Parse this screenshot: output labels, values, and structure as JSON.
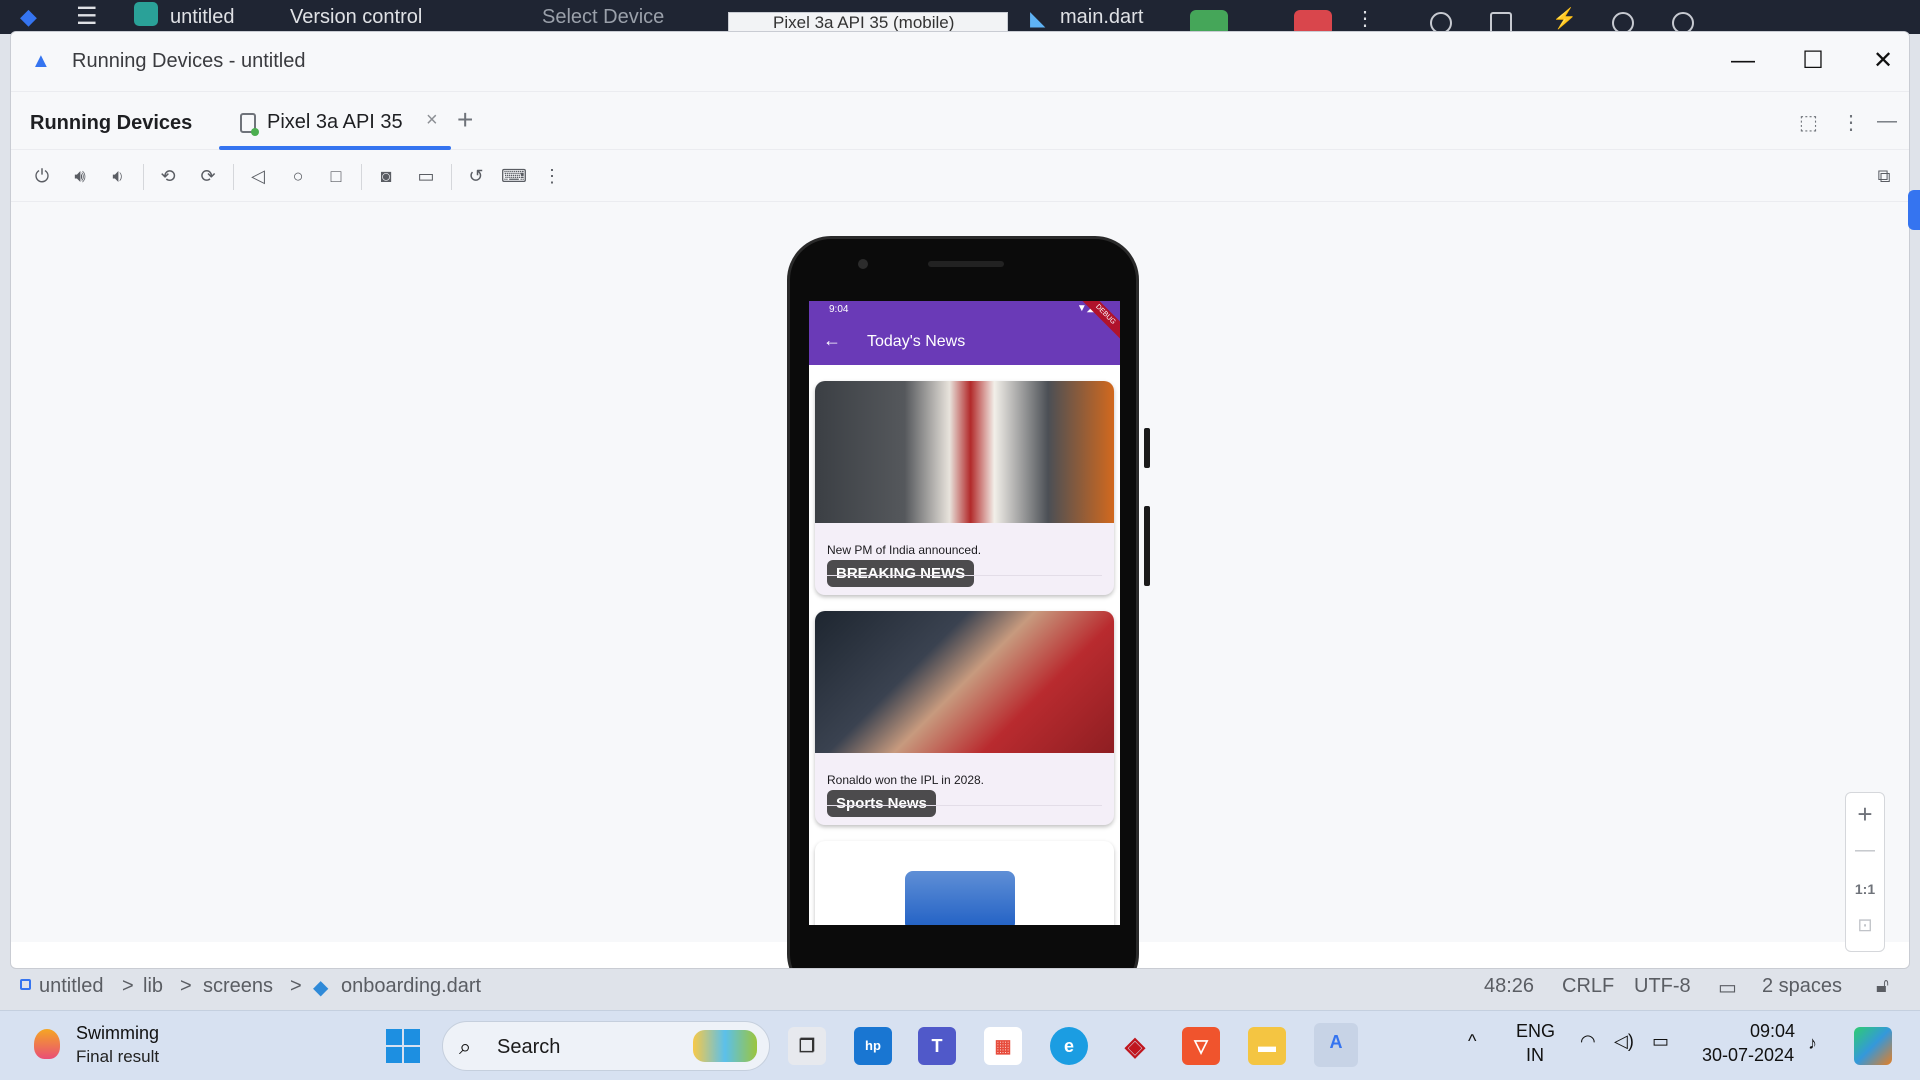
{
  "bg_ide": {
    "project": "untitled",
    "vcs": "Version control",
    "device_select": "Select Device",
    "device_combo": "Pixel 3a API 35 (mobile)",
    "run_config": "main.dart"
  },
  "window": {
    "title": "Running Devices - untitled",
    "minimize": "—",
    "maximize": "☐",
    "close": "✕"
  },
  "panel": {
    "title": "Running Devices",
    "tab_label": "Pixel 3a API 35",
    "tab_close": "×",
    "add_tab": "+"
  },
  "toolbar": {
    "icons": [
      "power-icon",
      "volume-up-icon",
      "volume-down-icon",
      "rotate-left-icon",
      "rotate-right-icon",
      "back-icon",
      "home-icon",
      "overview-icon",
      "screenshot-icon",
      "record-icon",
      "reset-icon",
      "keyboard-icon",
      "more-icon"
    ]
  },
  "emulator": {
    "status_time": "9:04",
    "app_title": "Today's News",
    "debug_banner": "DEBUG",
    "cards": [
      {
        "tag": "BREAKING NEWS",
        "desc": "New PM of India announced."
      },
      {
        "tag": "Sports News",
        "desc": "Ronaldo won the IPL in 2028."
      }
    ]
  },
  "zoom": {
    "plus": "+",
    "minus": "—",
    "actual": "1:1"
  },
  "breadcrumb": {
    "project": "untitled",
    "lib": "lib",
    "screens": "screens",
    "file": "onboarding.dart",
    "sep": ">"
  },
  "status": {
    "position": "48:26",
    "line_sep": "CRLF",
    "encoding": "UTF-8",
    "indent": "2 spaces"
  },
  "taskbar": {
    "widget_title": "Swimming",
    "widget_sub": "Final result",
    "search_placeholder": "Search",
    "lang_top": "ENG",
    "lang_bottom": "IN",
    "time": "09:04",
    "date": "30-07-2024"
  },
  "colors": {
    "accent": "#3574f0",
    "app_bar": "#6a3ab7",
    "run_green": "#45a659",
    "stop_red": "#d9464c"
  }
}
